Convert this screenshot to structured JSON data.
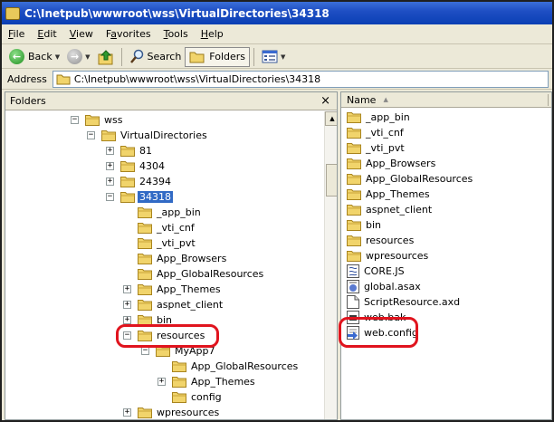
{
  "window": {
    "title": "C:\\Inetpub\\wwwroot\\wss\\VirtualDirectories\\34318"
  },
  "menu": [
    {
      "label": "File",
      "key": "F",
      "rest": "ile"
    },
    {
      "label": "Edit",
      "key": "E",
      "rest": "dit"
    },
    {
      "label": "View",
      "key": "V",
      "rest": "iew"
    },
    {
      "label": "Favorites",
      "key": "a",
      "pre": "F",
      "rest": "vorites"
    },
    {
      "label": "Tools",
      "key": "T",
      "rest": "ools"
    },
    {
      "label": "Help",
      "key": "H",
      "rest": "elp"
    }
  ],
  "toolbar": {
    "back_label": "Back",
    "search_label": "Search",
    "folders_label": "Folders"
  },
  "address": {
    "label": "Address",
    "value": "C:\\Inetpub\\wwwroot\\wss\\VirtualDirectories\\34318"
  },
  "folders_pane": {
    "title": "Folders",
    "close_glyph": "×",
    "tree": [
      {
        "label": "wss",
        "expander": "-",
        "selected": false
      },
      {
        "label": "VirtualDirectories",
        "expander": "-",
        "selected": false
      },
      {
        "label": "81",
        "expander": "+",
        "selected": false
      },
      {
        "label": "4304",
        "expander": "+",
        "selected": false
      },
      {
        "label": "24394",
        "expander": "+",
        "selected": false
      },
      {
        "label": "34318",
        "expander": "-",
        "selected": true
      },
      {
        "label": "_app_bin",
        "expander": "",
        "selected": false
      },
      {
        "label": "_vti_cnf",
        "expander": "",
        "selected": false
      },
      {
        "label": "_vti_pvt",
        "expander": "",
        "selected": false
      },
      {
        "label": "App_Browsers",
        "expander": "",
        "selected": false
      },
      {
        "label": "App_GlobalResources",
        "expander": "",
        "selected": false
      },
      {
        "label": "App_Themes",
        "expander": "+",
        "selected": false
      },
      {
        "label": "aspnet_client",
        "expander": "+",
        "selected": false
      },
      {
        "label": "bin",
        "expander": "+",
        "selected": false
      },
      {
        "label": "resources",
        "expander": "-",
        "selected": false
      },
      {
        "label": "MyApp7",
        "expander": "-",
        "selected": false
      },
      {
        "label": "App_GlobalResources",
        "expander": "",
        "selected": false
      },
      {
        "label": "App_Themes",
        "expander": "+",
        "selected": false
      },
      {
        "label": "config",
        "expander": "",
        "selected": false
      },
      {
        "label": "wpresources",
        "expander": "+",
        "selected": false
      }
    ]
  },
  "files_pane": {
    "column_name": "Name",
    "items": [
      {
        "label": "_app_bin",
        "kind": "folder"
      },
      {
        "label": "_vti_cnf",
        "kind": "folder"
      },
      {
        "label": "_vti_pvt",
        "kind": "folder"
      },
      {
        "label": "App_Browsers",
        "kind": "folder"
      },
      {
        "label": "App_GlobalResources",
        "kind": "folder"
      },
      {
        "label": "App_Themes",
        "kind": "folder"
      },
      {
        "label": "aspnet_client",
        "kind": "folder"
      },
      {
        "label": "bin",
        "kind": "folder"
      },
      {
        "label": "resources",
        "kind": "folder"
      },
      {
        "label": "wpresources",
        "kind": "folder"
      },
      {
        "label": "CORE.JS",
        "kind": "script-file"
      },
      {
        "label": "global.asax",
        "kind": "asax-file"
      },
      {
        "label": "ScriptResource.axd",
        "kind": "generic-file"
      },
      {
        "label": "web.bak",
        "kind": "bak-file"
      },
      {
        "label": "web.config",
        "kind": "config-file"
      }
    ]
  },
  "colors": {
    "titlebar": "#0a3fb4",
    "selection": "#316ac5",
    "highlight": "#e0141e",
    "folder": "#f1d46b"
  }
}
